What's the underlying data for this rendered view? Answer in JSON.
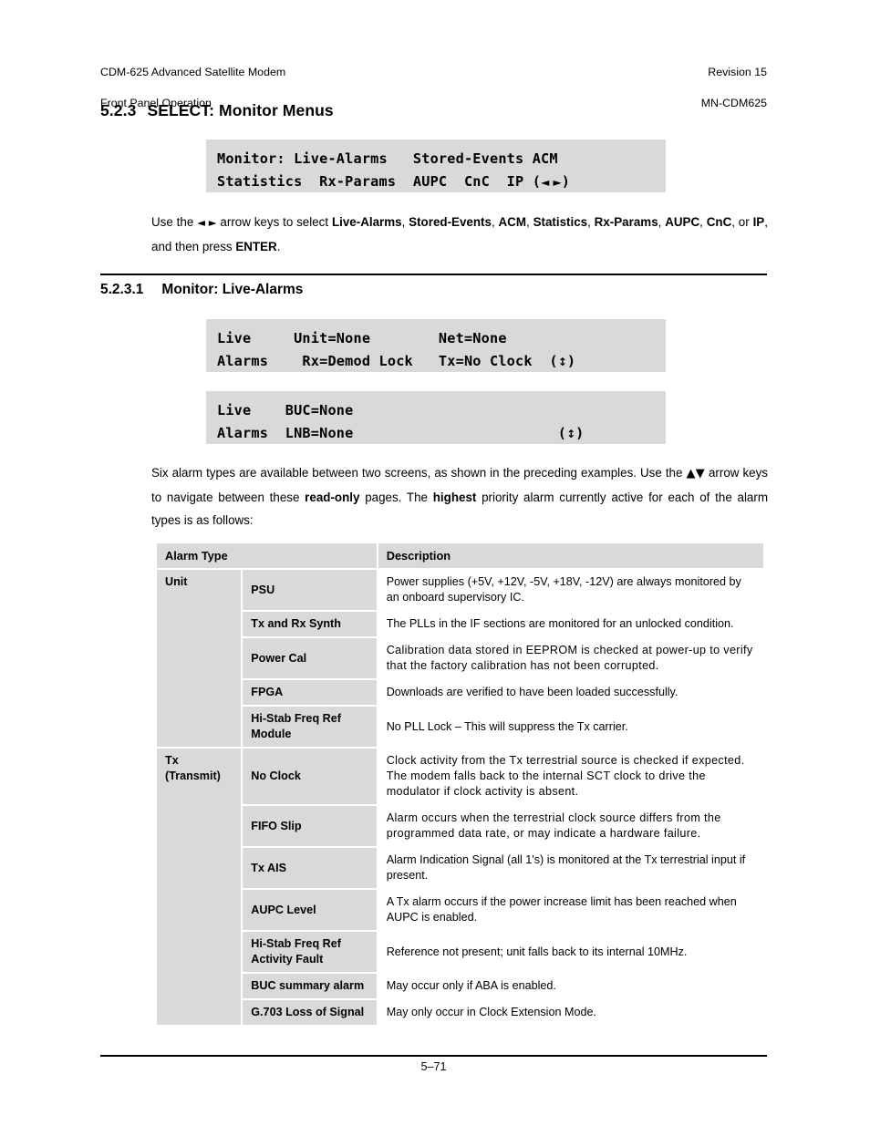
{
  "header": {
    "left_line1": "CDM-625 Advanced Satellite Modem",
    "left_line2": "Front Panel Operation",
    "right_line1": "Revision 15",
    "right_line2": "MN-CDM625"
  },
  "section": {
    "number": "5.2.3",
    "title": "SELECT: Monitor Menus"
  },
  "subsection": {
    "number": "5.2.3.1",
    "title": "Monitor: Live-Alarms"
  },
  "lcd_monitor": {
    "line1": "Monitor: Live-Alarms   Stored-Events ACM",
    "line2_pre": "Statistics  Rx-Params  AUPC  CnC  IP (",
    "line2_arrows": "◄ ►",
    "line2_post": ")"
  },
  "lcd_live_alarms_1": {
    "line1": "Live     Unit=None        Net=None",
    "line2_pre": "Alarms    Rx=Demod Lock   Tx=No Clock  (",
    "line2_arrows": "↕",
    "line2_post": ")"
  },
  "lcd_live_alarms_2": {
    "line1": "Live    BUC=None",
    "line2_pre": "Alarms  LNB=None                        (",
    "line2_arrows": "↕",
    "line2_post": ")"
  },
  "paragraph_select": {
    "t1": "Use the ",
    "arrows": "◄ ►",
    "t2": " arrow keys to select ",
    "b1": "Live-Alarms",
    "t3": ", ",
    "b2": "Stored-Events",
    "t4": ", ",
    "b3": "ACM",
    "t5": ", ",
    "b4": "Statistics",
    "t6": ", ",
    "b5": "Rx-Params",
    "t7": ", ",
    "b6": "AUPC",
    "t8": ", ",
    "b7": "CnC",
    "t9": ", or ",
    "b8": "IP",
    "t10": ", and then press ",
    "b9": "ENTER",
    "t11": "."
  },
  "paragraph_alarms": {
    "t1": "Six alarm types are available between two screens, as shown in the preceding examples. Use the ",
    "arrows": "▲▼",
    "t2": " arrow keys to navigate between these ",
    "b1": "read-only",
    "t3": " pages. The ",
    "b2": "highest",
    "t4": " priority alarm currently active for each of the alarm types is as follows:"
  },
  "table": {
    "headers": {
      "alarm_type": "Alarm Type",
      "description": "Description"
    },
    "groups": [
      {
        "group": "Unit",
        "group_line2": "",
        "rows": [
          {
            "name": "PSU",
            "desc": "Power supplies (+5V, +12V, -5V, +18V, -12V) are always monitored by an onboard supervisory IC."
          },
          {
            "name": "Tx and Rx Synth",
            "desc": "The PLLs in the IF sections are monitored for an unlocked condition."
          },
          {
            "name": "Power Cal",
            "desc": "Calibration data stored in EEPROM is checked at power-up to verify that the factory calibration has not been corrupted."
          },
          {
            "name": "FPGA",
            "desc": "Downloads are verified to have been loaded successfully."
          },
          {
            "name": "Hi-Stab Freq Ref Module",
            "desc": "No PLL Lock – This will suppress the Tx carrier."
          }
        ]
      },
      {
        "group": "Tx",
        "group_line2": "(Transmit)",
        "rows": [
          {
            "name": "No Clock",
            "desc": "Clock activity from the Tx terrestrial source is checked if expected. The modem falls back to the internal SCT clock to drive the modulator if clock activity is absent."
          },
          {
            "name": "FIFO Slip",
            "desc": "Alarm occurs when the terrestrial clock source differs from the programmed data rate, or may indicate a hardware failure."
          },
          {
            "name": "Tx AIS",
            "desc": "Alarm Indication Signal (all 1's) is monitored at the Tx terrestrial input if present."
          },
          {
            "name": "AUPC Level",
            "desc": "A Tx alarm occurs if the power increase limit has been reached when AUPC is enabled."
          },
          {
            "name": "Hi-Stab Freq Ref Activity Fault",
            "desc": "Reference not present; unit falls back to its internal 10MHz."
          },
          {
            "name": "BUC summary alarm",
            "desc": "May occur only if ABA is enabled."
          },
          {
            "name": "G.703 Loss of Signal",
            "desc": "May only occur in Clock Extension Mode."
          }
        ]
      }
    ]
  },
  "footer": {
    "page_number": "5–71"
  }
}
